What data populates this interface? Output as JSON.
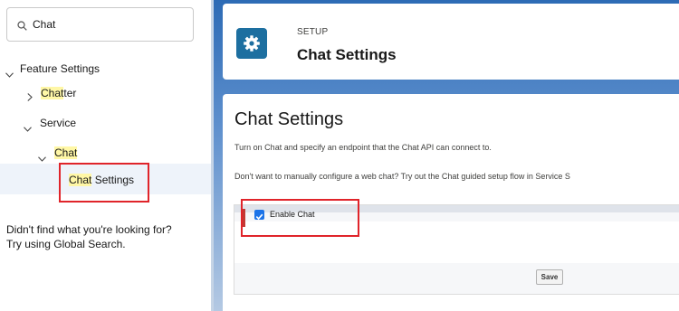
{
  "sidebar": {
    "search": {
      "value": "Chat",
      "icon": "search-icon"
    },
    "tree": {
      "feature_settings": "Feature Settings",
      "chatter_hl": "Chat",
      "chatter_rest": "ter",
      "service": "Service",
      "chat": "Chat",
      "chat_settings_hl": "Chat",
      "chat_settings_rest": " Settings"
    },
    "not_found_line1": "Didn't find what you're looking for?",
    "not_found_line2": "Try using Global Search."
  },
  "header": {
    "setup_label": "SETUP",
    "title": "Chat Settings",
    "icon": "gear-icon",
    "icon_color": "#1d6fa0"
  },
  "content": {
    "page_title": "Chat Settings",
    "description_1": "Turn on Chat and specify an endpoint that the Chat API can connect to.",
    "description_2": "Don't want to manually configure a web chat? Try out the Chat guided setup flow in Service S",
    "enable_chat_label": "Enable Chat",
    "enable_chat_checked": true,
    "save_label": "Save"
  },
  "colors": {
    "highlight": "#fff7a6",
    "annotation_red": "#e0242a",
    "checkbox_blue": "#1b73e8"
  }
}
